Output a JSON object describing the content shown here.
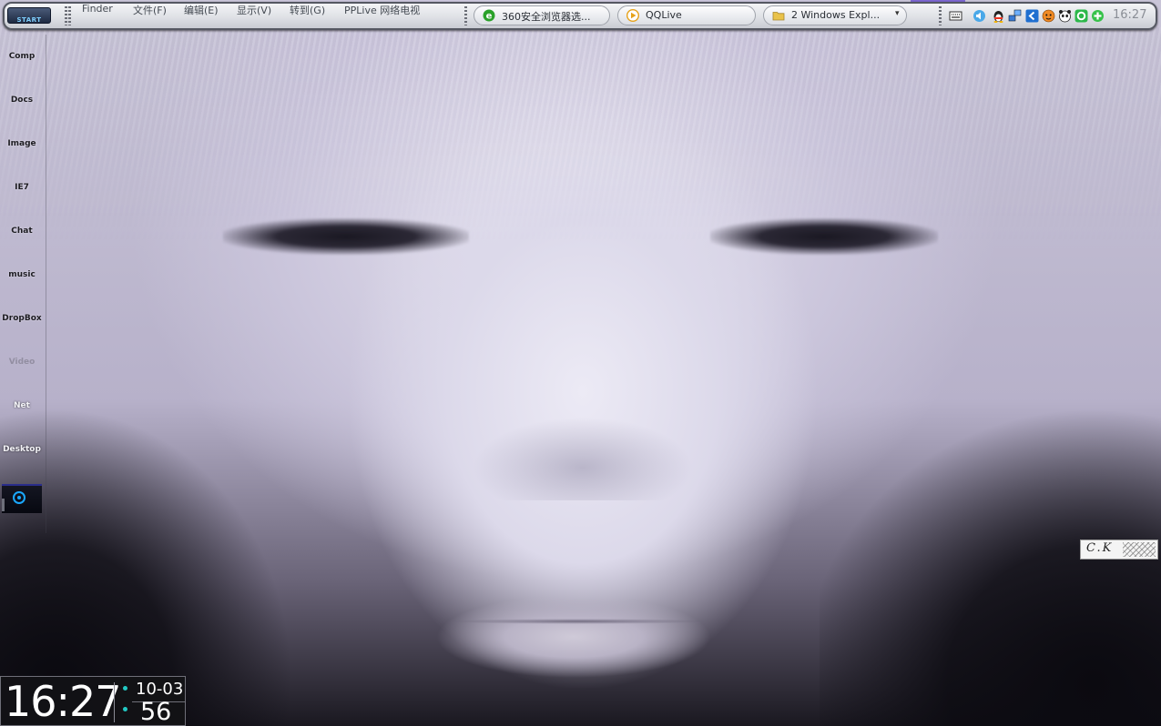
{
  "topbar": {
    "start_label": "START",
    "menu": [
      "Finder",
      "文件(F)",
      "编辑(E)",
      "显示(V)",
      "转到(G)",
      "PPLive 网络电视"
    ],
    "tasks": [
      {
        "label": "360安全浏览器选...",
        "icon": "globe-e-icon",
        "color": "#2aa12a"
      },
      {
        "label": "QQLive",
        "icon": "qqlive-play-icon",
        "color": "#e6a21a"
      },
      {
        "label": "2 Windows Expl...",
        "icon": "folder-icon",
        "color": "#e9c24a",
        "dropdown": "▾"
      }
    ],
    "tray_icons": [
      "keyboard-icon",
      "volume-icon",
      "qq-penguin-icon",
      "network-icon",
      "back-arrow-icon",
      "tiger-icon",
      "panda-icon",
      "green-ring-icon",
      "green-shield-icon"
    ],
    "clock": "16:27"
  },
  "dock": {
    "items": [
      {
        "label": "Comp"
      },
      {
        "label": "Docs"
      },
      {
        "label": "Image"
      },
      {
        "label": "IE7"
      },
      {
        "label": "Chat"
      },
      {
        "label": "music"
      },
      {
        "label": "DropBox"
      },
      {
        "label": "Video"
      },
      {
        "label": "Net"
      },
      {
        "label": "Desktop"
      }
    ]
  },
  "clock_widget": {
    "time": "16:27",
    "date": "10-03",
    "seconds": "56"
  },
  "signature": {
    "text": "C.K"
  },
  "colors": {
    "accent": "#22c9c3",
    "dock_widget_ring": "#1aa8ff"
  }
}
